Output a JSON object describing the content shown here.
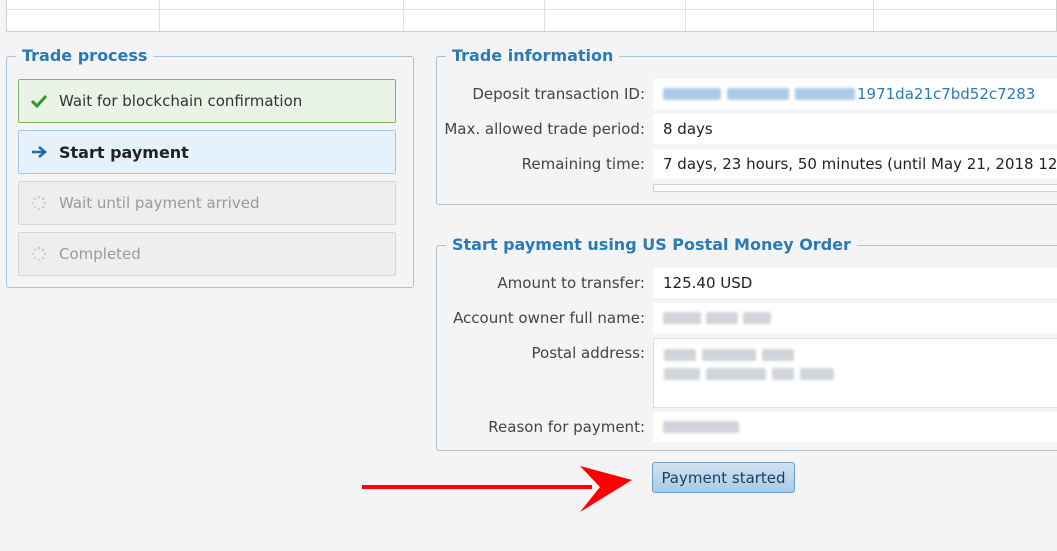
{
  "trade_process": {
    "title": "Trade process",
    "steps": [
      {
        "label": "Wait for blockchain confirmation",
        "state": "done",
        "icon": "checkmark-icon"
      },
      {
        "label": "Start payment",
        "state": "active",
        "icon": "arrow-right-icon"
      },
      {
        "label": "Wait until payment arrived",
        "state": "pending",
        "icon": "spinner-icon"
      },
      {
        "label": "Completed",
        "state": "pending",
        "icon": "spinner-icon"
      }
    ]
  },
  "trade_information": {
    "title": "Trade information",
    "deposit_tx_label": "Deposit transaction ID:",
    "deposit_tx_value_visible": "1971da21c7bd52c7283",
    "max_period_label": "Max. allowed trade period:",
    "max_period_value": "8 days",
    "remaining_label": "Remaining time:",
    "remaining_value": "7 days, 23 hours, 50 minutes (until May 21, 2018 12"
  },
  "start_payment": {
    "title": "Start payment using US Postal Money Order",
    "amount_label": "Amount to transfer:",
    "amount_value": "125.40 USD",
    "owner_label": "Account owner full name:",
    "postal_label": "Postal address:",
    "reason_label": "Reason for payment:"
  },
  "payment_started_button": "Payment started",
  "colors": {
    "accent": "#2a7ab8",
    "done_border": "#7fb36c",
    "arrow": "#ff0000"
  }
}
